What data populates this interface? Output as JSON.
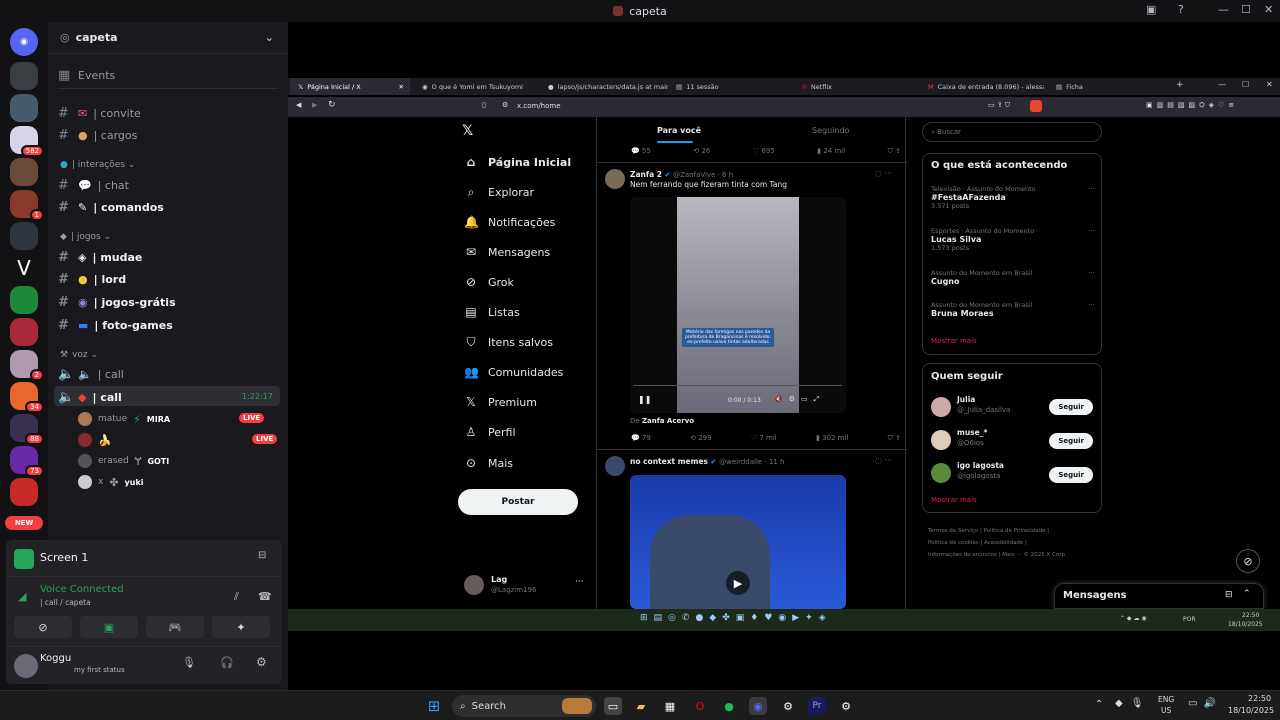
{
  "discord": {
    "title": "capeta",
    "server_name": "capeta",
    "events": "Events",
    "channels_top": [
      {
        "name": "| convite"
      },
      {
        "name": "| cargos"
      }
    ],
    "cat_interacoes": "| interações",
    "channels_mid": [
      {
        "name": "| chat"
      },
      {
        "name": "| comandos"
      }
    ],
    "cat_jogos": "| jogos",
    "channels_jogos": [
      {
        "name": "| mudae"
      },
      {
        "name": "| lord"
      },
      {
        "name": "| jogos-grátis"
      },
      {
        "name": "| foto-games"
      }
    ],
    "cat_voz": "voz",
    "voice_channels": [
      {
        "name": "| call"
      },
      {
        "name": "| call",
        "timer": "1:22:17"
      }
    ],
    "voice_users": [
      {
        "name": "matue",
        "tag": "MIRA",
        "live": "LIVE"
      },
      {
        "name": "",
        "tag": "",
        "live": "LIVE"
      },
      {
        "name": "erased",
        "tag": "GOTI",
        "live": ""
      },
      {
        "name": "x",
        "tag": "yuki",
        "live": ""
      }
    ],
    "badges": {
      "b1": "582",
      "b2": "1",
      "b3": "2",
      "b4": "34",
      "b5": "88",
      "b6": "73",
      "new": "NEW"
    },
    "screen_label": "Screen 1",
    "voice_status": "Voice Connected",
    "voice_location": "| call / capeta",
    "user_name": "Koggu",
    "user_status": "my first status"
  },
  "browser": {
    "tabs": [
      "Página Inicial / X",
      "O que é Yomi em Tsukuyomi",
      "lapso/js/characters/data.js at main",
      "11 sessão",
      "Netflix",
      "Caixa de entrada (8.096) - alessandr",
      "Ficha"
    ],
    "url": "x.com/home"
  },
  "x": {
    "nav": [
      "Página Inicial",
      "Explorar",
      "Notificações",
      "Mensagens",
      "Grok",
      "Listas",
      "Itens salvos",
      "Comunidades",
      "Premium",
      "Perfil",
      "Mais"
    ],
    "post_button": "Postar",
    "account_name": "Lag",
    "account_handle": "@Lagzim196",
    "feed_tabs": [
      "Para você",
      "Seguindo"
    ],
    "top_stats": [
      "55",
      "26",
      "695",
      "24 mil"
    ],
    "post1": {
      "name": "Zanfa 2",
      "handle": "@ZanfaVive · 6 h",
      "text": "Nem ferrando que fizeram tinta com Tang",
      "caption": "Mistério das formigas nas paredes da prefeitura de Bragancinas é resolvido: ex-prefeito usava tintas adulteradas",
      "time": "0:00 / 0:13",
      "from_prefix": "De",
      "from": "Zanfa Acervo",
      "stats": [
        "79",
        "299",
        "7 mil",
        "302 mil"
      ]
    },
    "post2": {
      "name": "no context memes",
      "handle": "@weirddalle · 11 h"
    },
    "search_placeholder": "Buscar",
    "trends_title": "O que está acontecendo",
    "trends": [
      {
        "sub": "Televisão · Assunto do Momento",
        "title": "#FestaAFazenda",
        "count": "3.571 posts"
      },
      {
        "sub": "Esportes · Assunto do Momento",
        "title": "Lucas Silva",
        "count": "1.573 posts"
      },
      {
        "sub": "Assunto do Momento em Brasil",
        "title": "Cugno",
        "count": ""
      },
      {
        "sub": "Assunto do Momento em Brasil",
        "title": "Bruna Moraes",
        "count": ""
      }
    ],
    "show_more": "Mostrar mais",
    "follow_title": "Quem seguir",
    "follow": [
      {
        "name": "Julia",
        "handle": "@_Julia_dasilva"
      },
      {
        "name": "muse_*",
        "handle": "@O6ios"
      },
      {
        "name": "igo lagosta",
        "handle": "@igolagosta"
      }
    ],
    "follow_label": "Seguir",
    "show_more2": "Mostrar mais",
    "footer1": "Termos de Serviço | Política de Privacidade |",
    "footer2": "Política de cookies | Acessibilidade |",
    "footer3": "Informações de anúncios | Mais ··· © 2025 X Corp.",
    "messages": "Mensagens"
  },
  "inner_tray": {
    "lang": "POR",
    "time": "22:50",
    "date": "18/10/2025"
  },
  "taskbar": {
    "search": "Search",
    "lang1": "ENG",
    "lang2": "US",
    "time": "22:50",
    "date": "18/10/2025"
  }
}
